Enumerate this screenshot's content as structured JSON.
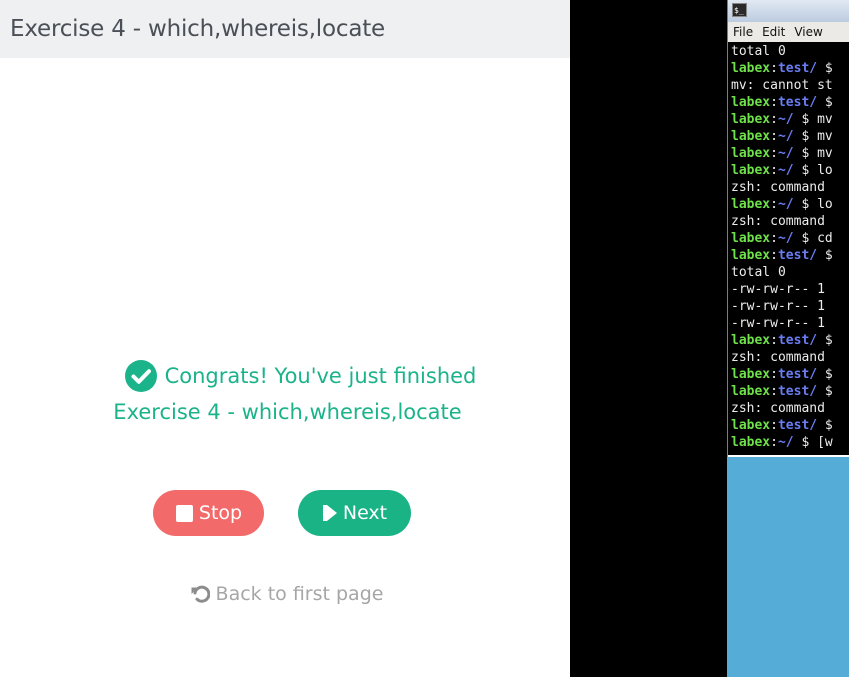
{
  "header": {
    "title": "Exercise 4 - which,whereis,locate"
  },
  "congrats": {
    "line1": "Congrats! You've just finished",
    "line2": "Exercise 4 - which,whereis,locate"
  },
  "buttons": {
    "stop_label": "Stop",
    "next_label": "Next"
  },
  "back_link": {
    "label": "Back to first page"
  },
  "terminal": {
    "menu": [
      "File",
      "Edit",
      "View"
    ],
    "lines": [
      {
        "text": "total 0"
      },
      {
        "user": "labex",
        "dir": "test/",
        "rest": " $"
      },
      {
        "text": "mv: cannot st"
      },
      {
        "user": "labex",
        "dir": "test/",
        "rest": " $"
      },
      {
        "user": "labex",
        "dir": "~/",
        "rest": " $ mv"
      },
      {
        "user": "labex",
        "dir": "~/",
        "rest": " $ mv"
      },
      {
        "user": "labex",
        "dir": "~/",
        "rest": " $ mv"
      },
      {
        "user": "labex",
        "dir": "~/",
        "rest": " $ lo"
      },
      {
        "text": "zsh: command"
      },
      {
        "user": "labex",
        "dir": "~/",
        "rest": " $ lo"
      },
      {
        "text": "zsh: command"
      },
      {
        "user": "labex",
        "dir": "~/",
        "rest": " $ cd"
      },
      {
        "user": "labex",
        "dir": "test/",
        "rest": " $"
      },
      {
        "text": "total 0"
      },
      {
        "text": "-rw-rw-r-- 1"
      },
      {
        "text": "-rw-rw-r-- 1"
      },
      {
        "text": "-rw-rw-r-- 1"
      },
      {
        "user": "labex",
        "dir": "test/",
        "rest": " $"
      },
      {
        "text": "zsh: command"
      },
      {
        "user": "labex",
        "dir": "test/",
        "rest": " $"
      },
      {
        "user": "labex",
        "dir": "test/",
        "rest": " $"
      },
      {
        "text": "zsh: command"
      },
      {
        "user": "labex",
        "dir": "test/",
        "rest": " $"
      },
      {
        "user": "labex",
        "dir": "~/",
        "rest": " $ [w"
      }
    ]
  },
  "colors": {
    "accent_green": "#1bb38a",
    "stop_red": "#f26a6a",
    "prompt_user": "#6ee04a",
    "prompt_dir": "#6a7df2",
    "desktop_blue": "#55acd6"
  },
  "icons": {
    "check": "check-circle-icon",
    "stop": "stop-icon",
    "next": "skip-forward-icon",
    "back": "undo-icon",
    "terminal": "terminal-icon"
  }
}
